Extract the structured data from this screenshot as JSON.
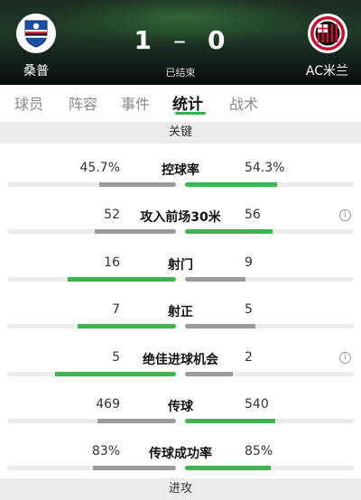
{
  "colors": {
    "win": "#3fb34f",
    "lose": "#9a9a9a",
    "track": "#ececec",
    "accent": "#2db34a"
  },
  "match": {
    "home_team": "桑普",
    "away_team": "AC米兰",
    "home_score": "1",
    "separator": "–",
    "away_score": "0",
    "status": "已结束",
    "home_logo_icon": "sampdoria-crest-icon",
    "away_logo_icon": "ac-milan-crest-icon"
  },
  "tabs": [
    {
      "label": "球员",
      "active": false
    },
    {
      "label": "阵容",
      "active": false
    },
    {
      "label": "事件",
      "active": false
    },
    {
      "label": "统计",
      "active": true
    },
    {
      "label": "战术",
      "active": false
    }
  ],
  "sections": {
    "key": "关键",
    "attack": "进攻"
  },
  "stats": [
    {
      "label": "控球率",
      "home": "45.7%",
      "away": "54.3%",
      "home_value": 45.7,
      "away_value": 54.3,
      "info": false
    },
    {
      "label": "攻入前场30米",
      "home": "52",
      "away": "56",
      "home_value": 52,
      "away_value": 56,
      "info": true
    },
    {
      "label": "射门",
      "home": "16",
      "away": "9",
      "home_value": 16,
      "away_value": 9,
      "info": false
    },
    {
      "label": "射正",
      "home": "7",
      "away": "5",
      "home_value": 7,
      "away_value": 5,
      "info": false
    },
    {
      "label": "绝佳进球机会",
      "home": "5",
      "away": "2",
      "home_value": 5,
      "away_value": 2,
      "info": true
    },
    {
      "label": "传球",
      "home": "469",
      "away": "540",
      "home_value": 469,
      "away_value": 540,
      "info": false
    },
    {
      "label": "传球成功率",
      "home": "83%",
      "away": "85%",
      "home_value": 83,
      "away_value": 85,
      "info": false
    }
  ]
}
